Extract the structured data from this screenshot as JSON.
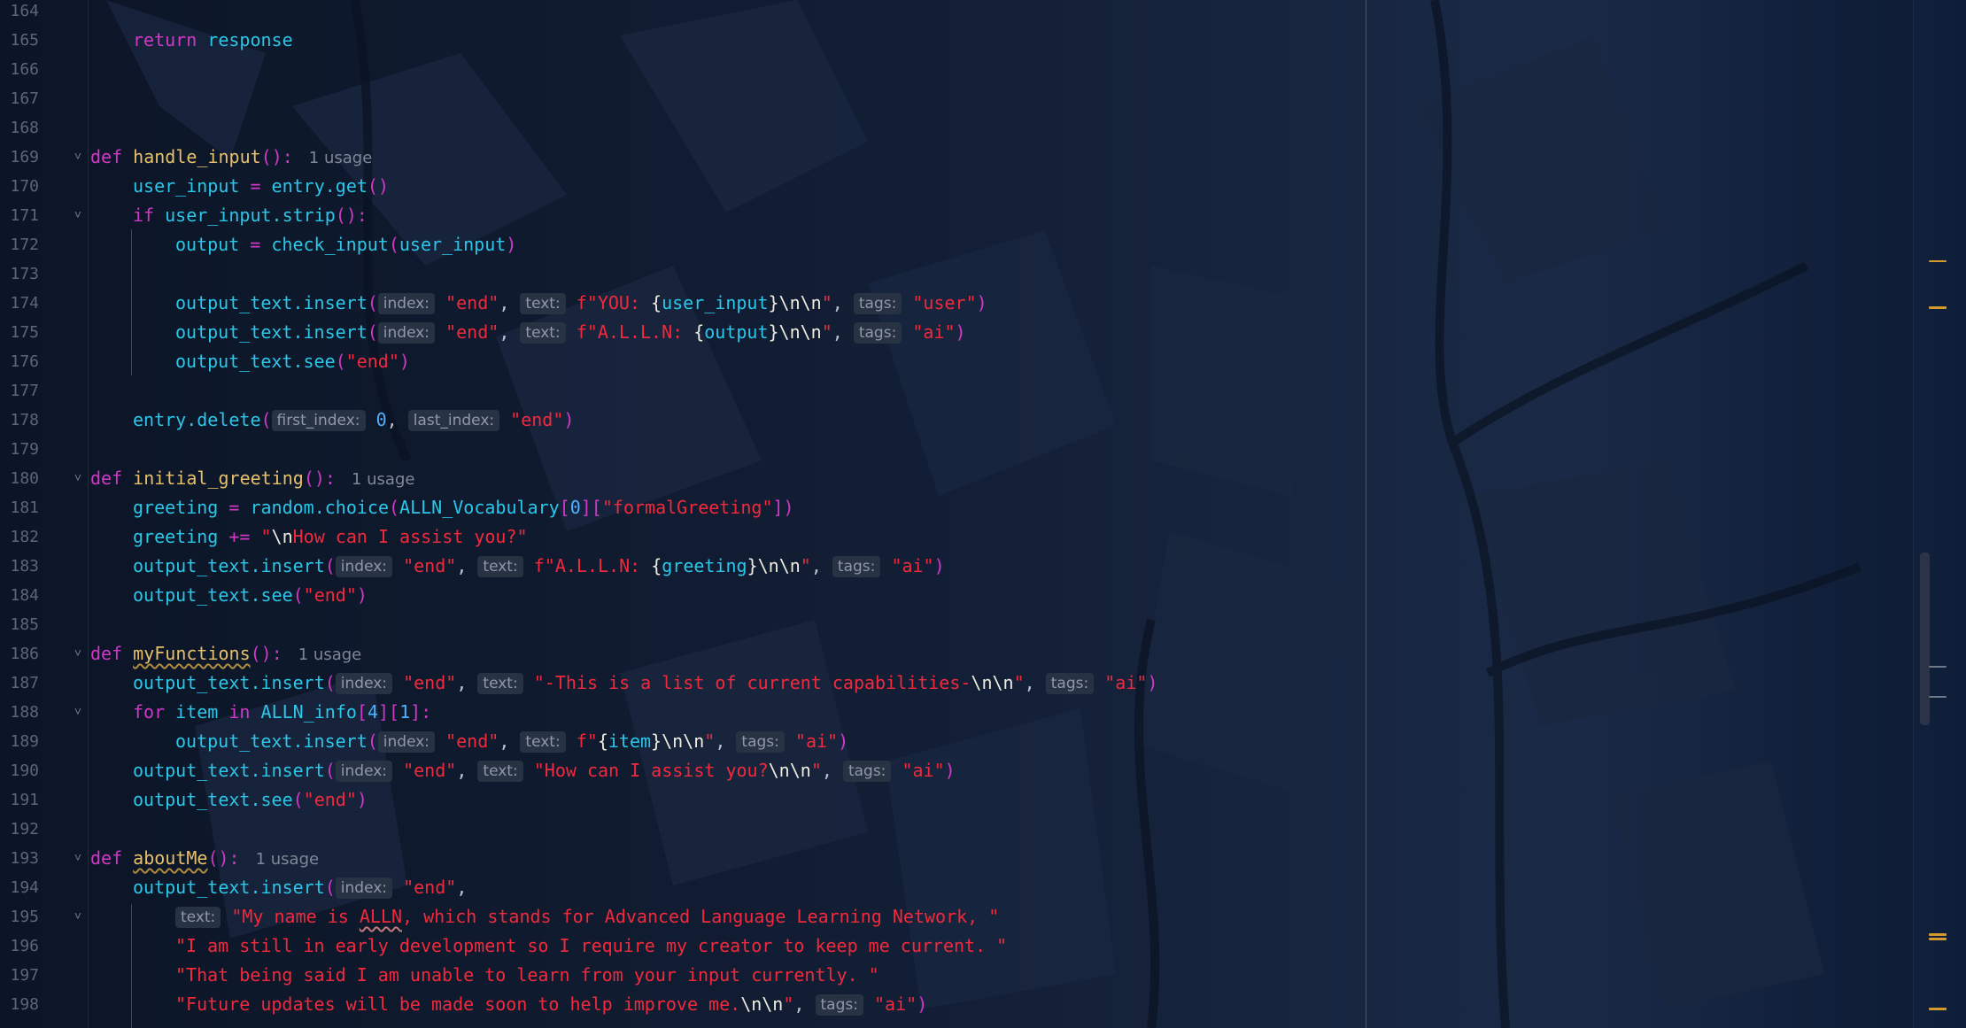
{
  "editor": {
    "theme_colors": {
      "background": "#0a1628",
      "keyword": "#d238c8",
      "function_name": "#e8c06a",
      "identifier": "#2bc6e8",
      "string": "#f02a3c",
      "number": "#4fb0ff",
      "line_number": "#5d6677",
      "hint_bg": "#273243",
      "warning_mark": "#d49a2e"
    },
    "lines": [
      {
        "n": "164",
        "tokens": []
      },
      {
        "n": "165",
        "indent": 1,
        "tokens": [
          {
            "t": "return",
            "c": "k"
          },
          {
            "t": " "
          },
          {
            "t": "response",
            "c": "id"
          }
        ]
      },
      {
        "n": "166",
        "tokens": []
      },
      {
        "n": "167",
        "tokens": []
      },
      {
        "n": "168",
        "tokens": []
      },
      {
        "n": "169",
        "fold": "open",
        "tokens": [
          {
            "t": "def",
            "c": "k"
          },
          {
            "t": " "
          },
          {
            "t": "handle_input",
            "c": "fn"
          },
          {
            "t": "():",
            "c": "p"
          },
          {
            "usage": "1 usage"
          }
        ]
      },
      {
        "n": "170",
        "indent": 1,
        "tokens": [
          {
            "t": "user_input",
            "c": "id"
          },
          {
            "t": " = ",
            "c": "op"
          },
          {
            "t": "entry.get",
            "c": "id"
          },
          {
            "t": "()",
            "c": "p"
          }
        ]
      },
      {
        "n": "171",
        "indent": 1,
        "fold": "open",
        "tokens": [
          {
            "t": "if",
            "c": "k"
          },
          {
            "t": " "
          },
          {
            "t": "user_input.strip",
            "c": "id"
          },
          {
            "t": "():",
            "c": "p"
          }
        ]
      },
      {
        "n": "172",
        "indent": 2,
        "tokens": [
          {
            "t": "output",
            "c": "id"
          },
          {
            "t": " = ",
            "c": "op"
          },
          {
            "t": "check_input",
            "c": "id"
          },
          {
            "t": "(",
            "c": "p"
          },
          {
            "t": "user_input",
            "c": "id"
          },
          {
            "t": ")",
            "c": "p"
          }
        ]
      },
      {
        "n": "173",
        "tokens": []
      },
      {
        "n": "174",
        "indent": 2,
        "tokens": [
          {
            "t": "output_text.insert",
            "c": "id"
          },
          {
            "t": "(",
            "c": "p"
          },
          {
            "hint": "index:"
          },
          {
            "t": "\"end\"",
            "c": "s"
          },
          {
            "t": ", ",
            "c": "dflt"
          },
          {
            "hint": "text:"
          },
          {
            "t": "f\"YOU: ",
            "c": "s"
          },
          {
            "t": "{",
            "c": "br"
          },
          {
            "t": "user_input",
            "c": "id"
          },
          {
            "t": "}",
            "c": "br"
          },
          {
            "t": "\\n\\n",
            "c": "esc"
          },
          {
            "t": "\"",
            "c": "s"
          },
          {
            "t": ", ",
            "c": "dflt"
          },
          {
            "hint": "tags:"
          },
          {
            "t": "\"user\"",
            "c": "s"
          },
          {
            "t": ")",
            "c": "p"
          }
        ]
      },
      {
        "n": "175",
        "indent": 2,
        "tokens": [
          {
            "t": "output_text.insert",
            "c": "id"
          },
          {
            "t": "(",
            "c": "p"
          },
          {
            "hint": "index:"
          },
          {
            "t": "\"end\"",
            "c": "s"
          },
          {
            "t": ", ",
            "c": "dflt"
          },
          {
            "hint": "text:"
          },
          {
            "t": "f\"A.L.L.N: ",
            "c": "s"
          },
          {
            "t": "{",
            "c": "br"
          },
          {
            "t": "output",
            "c": "id"
          },
          {
            "t": "}",
            "c": "br"
          },
          {
            "t": "\\n\\n",
            "c": "esc"
          },
          {
            "t": "\"",
            "c": "s"
          },
          {
            "t": ", ",
            "c": "dflt"
          },
          {
            "hint": "tags:"
          },
          {
            "t": "\"ai\"",
            "c": "s"
          },
          {
            "t": ")",
            "c": "p"
          }
        ]
      },
      {
        "n": "176",
        "indent": 2,
        "tokens": [
          {
            "t": "output_text.see",
            "c": "id"
          },
          {
            "t": "(",
            "c": "p"
          },
          {
            "t": "\"end\"",
            "c": "s"
          },
          {
            "t": ")",
            "c": "p"
          }
        ]
      },
      {
        "n": "177",
        "tokens": []
      },
      {
        "n": "178",
        "indent": 1,
        "tokens": [
          {
            "t": "entry.delete",
            "c": "id"
          },
          {
            "t": "(",
            "c": "p"
          },
          {
            "hint": "first_index:"
          },
          {
            "t": "0",
            "c": "n"
          },
          {
            "t": ", ",
            "c": "dflt"
          },
          {
            "hint": "last_index:"
          },
          {
            "t": "\"end\"",
            "c": "s"
          },
          {
            "t": ")",
            "c": "p"
          }
        ]
      },
      {
        "n": "179",
        "tokens": []
      },
      {
        "n": "180",
        "fold": "open",
        "tokens": [
          {
            "t": "def",
            "c": "k"
          },
          {
            "t": " "
          },
          {
            "t": "initial_greeting",
            "c": "fn"
          },
          {
            "t": "():",
            "c": "p"
          },
          {
            "usage": "1 usage"
          }
        ]
      },
      {
        "n": "181",
        "indent": 1,
        "tokens": [
          {
            "t": "greeting",
            "c": "id"
          },
          {
            "t": " = ",
            "c": "op"
          },
          {
            "t": "random.choice",
            "c": "id"
          },
          {
            "t": "(",
            "c": "p"
          },
          {
            "t": "ALLN_Vocabulary",
            "c": "id"
          },
          {
            "t": "[",
            "c": "p"
          },
          {
            "t": "0",
            "c": "n"
          },
          {
            "t": "][",
            "c": "p"
          },
          {
            "t": "\"formalGreeting\"",
            "c": "s"
          },
          {
            "t": "])",
            "c": "p"
          }
        ]
      },
      {
        "n": "182",
        "indent": 1,
        "tokens": [
          {
            "t": "greeting",
            "c": "id"
          },
          {
            "t": " += ",
            "c": "op"
          },
          {
            "t": "\"",
            "c": "s"
          },
          {
            "t": "\\n",
            "c": "esc"
          },
          {
            "t": "How can I assist you?\"",
            "c": "s"
          }
        ]
      },
      {
        "n": "183",
        "indent": 1,
        "tokens": [
          {
            "t": "output_text.insert",
            "c": "id"
          },
          {
            "t": "(",
            "c": "p"
          },
          {
            "hint": "index:"
          },
          {
            "t": "\"end\"",
            "c": "s"
          },
          {
            "t": ", ",
            "c": "dflt"
          },
          {
            "hint": "text:"
          },
          {
            "t": "f\"A.L.L.N: ",
            "c": "s"
          },
          {
            "t": "{",
            "c": "br"
          },
          {
            "t": "greeting",
            "c": "id"
          },
          {
            "t": "}",
            "c": "br"
          },
          {
            "t": "\\n\\n",
            "c": "esc"
          },
          {
            "t": "\"",
            "c": "s"
          },
          {
            "t": ", ",
            "c": "dflt"
          },
          {
            "hint": "tags:"
          },
          {
            "t": "\"ai\"",
            "c": "s"
          },
          {
            "t": ")",
            "c": "p"
          }
        ]
      },
      {
        "n": "184",
        "indent": 1,
        "tokens": [
          {
            "t": "output_text.see",
            "c": "id"
          },
          {
            "t": "(",
            "c": "p"
          },
          {
            "t": "\"end\"",
            "c": "s"
          },
          {
            "t": ")",
            "c": "p"
          }
        ]
      },
      {
        "n": "185",
        "tokens": []
      },
      {
        "n": "186",
        "fold": "open",
        "tokens": [
          {
            "t": "def",
            "c": "k"
          },
          {
            "t": " "
          },
          {
            "t": "myFunctions",
            "c": "fn",
            "wavy": true
          },
          {
            "t": "():",
            "c": "p"
          },
          {
            "usage": "1 usage"
          }
        ]
      },
      {
        "n": "187",
        "indent": 1,
        "tokens": [
          {
            "t": "output_text.insert",
            "c": "id"
          },
          {
            "t": "(",
            "c": "p"
          },
          {
            "hint": "index:"
          },
          {
            "t": "\"end\"",
            "c": "s"
          },
          {
            "t": ", ",
            "c": "dflt"
          },
          {
            "hint": "text:"
          },
          {
            "t": "\"-This is a list of current capabilities-",
            "c": "s"
          },
          {
            "t": "\\n\\n",
            "c": "esc"
          },
          {
            "t": "\"",
            "c": "s"
          },
          {
            "t": ", ",
            "c": "dflt"
          },
          {
            "hint": "tags:"
          },
          {
            "t": "\"ai\"",
            "c": "s"
          },
          {
            "t": ")",
            "c": "p"
          }
        ]
      },
      {
        "n": "188",
        "indent": 1,
        "fold": "open",
        "tokens": [
          {
            "t": "for",
            "c": "k"
          },
          {
            "t": " "
          },
          {
            "t": "item",
            "c": "id"
          },
          {
            "t": " "
          },
          {
            "t": "in",
            "c": "k"
          },
          {
            "t": " "
          },
          {
            "t": "ALLN_info",
            "c": "id"
          },
          {
            "t": "[",
            "c": "p"
          },
          {
            "t": "4",
            "c": "n"
          },
          {
            "t": "][",
            "c": "p"
          },
          {
            "t": "1",
            "c": "n"
          },
          {
            "t": "]:",
            "c": "p"
          }
        ]
      },
      {
        "n": "189",
        "indent": 2,
        "tokens": [
          {
            "t": "output_text.insert",
            "c": "id"
          },
          {
            "t": "(",
            "c": "p"
          },
          {
            "hint": "index:"
          },
          {
            "t": "\"end\"",
            "c": "s"
          },
          {
            "t": ", ",
            "c": "dflt"
          },
          {
            "hint": "text:"
          },
          {
            "t": "f\"",
            "c": "s"
          },
          {
            "t": "{",
            "c": "br"
          },
          {
            "t": "item",
            "c": "id"
          },
          {
            "t": "}",
            "c": "br"
          },
          {
            "t": "\\n\\n",
            "c": "esc"
          },
          {
            "t": "\"",
            "c": "s"
          },
          {
            "t": ", ",
            "c": "dflt"
          },
          {
            "hint": "tags:"
          },
          {
            "t": "\"ai\"",
            "c": "s"
          },
          {
            "t": ")",
            "c": "p"
          }
        ]
      },
      {
        "n": "190",
        "indent": 1,
        "tokens": [
          {
            "t": "output_text.insert",
            "c": "id"
          },
          {
            "t": "(",
            "c": "p"
          },
          {
            "hint": "index:"
          },
          {
            "t": "\"end\"",
            "c": "s"
          },
          {
            "t": ", ",
            "c": "dflt"
          },
          {
            "hint": "text:"
          },
          {
            "t": "\"How can I assist you?",
            "c": "s"
          },
          {
            "t": "\\n\\n",
            "c": "esc"
          },
          {
            "t": "\"",
            "c": "s"
          },
          {
            "t": ", ",
            "c": "dflt"
          },
          {
            "hint": "tags:"
          },
          {
            "t": "\"ai\"",
            "c": "s"
          },
          {
            "t": ")",
            "c": "p"
          }
        ]
      },
      {
        "n": "191",
        "indent": 1,
        "tokens": [
          {
            "t": "output_text.see",
            "c": "id"
          },
          {
            "t": "(",
            "c": "p"
          },
          {
            "t": "\"end\"",
            "c": "s"
          },
          {
            "t": ")",
            "c": "p"
          }
        ]
      },
      {
        "n": "192",
        "tokens": []
      },
      {
        "n": "193",
        "fold": "open",
        "tokens": [
          {
            "t": "def",
            "c": "k"
          },
          {
            "t": " "
          },
          {
            "t": "aboutMe",
            "c": "fn",
            "wavy": true
          },
          {
            "t": "():",
            "c": "p"
          },
          {
            "usage": "1 usage"
          }
        ]
      },
      {
        "n": "194",
        "indent": 1,
        "tokens": [
          {
            "t": "output_text.insert",
            "c": "id"
          },
          {
            "t": "(",
            "c": "p"
          },
          {
            "hint": "index:"
          },
          {
            "t": "\"end\"",
            "c": "s"
          },
          {
            "t": ",",
            "c": "dflt"
          }
        ]
      },
      {
        "n": "195",
        "indent": 2,
        "fold": "open",
        "tokens": [
          {
            "hint": "text:"
          },
          {
            "t": "\"My name is ",
            "c": "s"
          },
          {
            "t": "ALLN",
            "c": "s",
            "wavys": true
          },
          {
            "t": ", which stands for Advanced Language Learning Network, \"",
            "c": "s"
          }
        ]
      },
      {
        "n": "196",
        "indent": 2,
        "tokens": [
          {
            "t": "\"I am still in early development so I require my creator to keep me current. \"",
            "c": "s"
          }
        ]
      },
      {
        "n": "197",
        "indent": 2,
        "tokens": [
          {
            "t": "\"That being said I am unable to learn from your input currently. \"",
            "c": "s"
          }
        ]
      },
      {
        "n": "198",
        "indent": 2,
        "tokens": [
          {
            "t": "\"Future updates will be made soon to help improve me.",
            "c": "s"
          },
          {
            "t": "\\n\\n",
            "c": "esc"
          },
          {
            "t": "\"",
            "c": "s"
          },
          {
            "t": ", ",
            "c": "dflt"
          },
          {
            "hint": "tags:"
          },
          {
            "t": "\"ai\"",
            "c": "s"
          },
          {
            "t": ")",
            "c": "p"
          }
        ]
      }
    ]
  }
}
